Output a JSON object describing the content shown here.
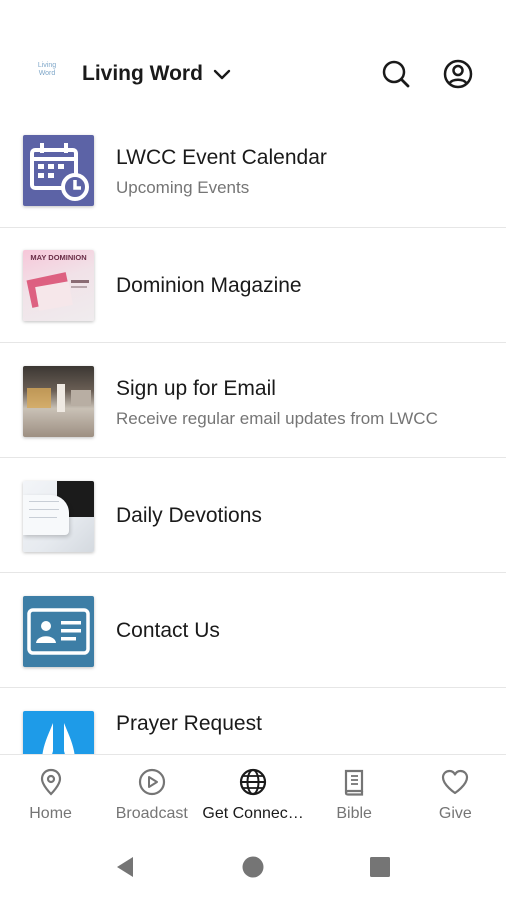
{
  "header": {
    "logo_text": "Living Word",
    "org_name": "Living Word",
    "icons": [
      "chevron-down-icon",
      "search-icon",
      "account-icon"
    ]
  },
  "items": [
    {
      "title": "LWCC Event Calendar",
      "subtitle": "Upcoming Events",
      "thumb": "calendar-icon"
    },
    {
      "title": "Dominion Magazine",
      "subtitle": "",
      "thumb": "magazine-cover",
      "thumb_text": "MAY DOMINION"
    },
    {
      "title": "Sign up for Email",
      "subtitle": "Receive regular email updates from LWCC",
      "thumb": "email-photo"
    },
    {
      "title": "Daily Devotions",
      "subtitle": "",
      "thumb": "open-book-photo"
    },
    {
      "title": "Contact Us",
      "subtitle": "",
      "thumb": "contact-card-icon"
    },
    {
      "title": "Prayer Request",
      "subtitle": "",
      "thumb": "praying-hands-icon"
    }
  ],
  "nav": [
    {
      "label": "Home",
      "icon": "location-pin-icon",
      "active": false
    },
    {
      "label": "Broadcast",
      "icon": "play-circle-icon",
      "active": false
    },
    {
      "label": "Get Connec…",
      "icon": "globe-icon",
      "active": true
    },
    {
      "label": "Bible",
      "icon": "book-icon",
      "active": false
    },
    {
      "label": "Give",
      "icon": "heart-icon",
      "active": false
    }
  ],
  "colors": {
    "calendar_bg": "#5c63a6",
    "contact_bg": "#3d7ea6",
    "prayer_bg": "#1e9be8",
    "text_primary": "#1a1a1a",
    "text_secondary": "#757575",
    "divider": "#e6e6e6"
  }
}
